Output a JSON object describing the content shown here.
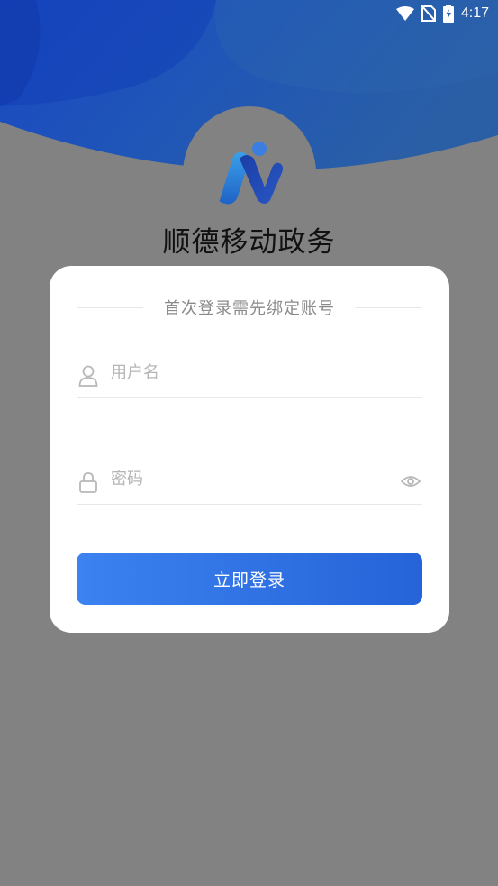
{
  "status_bar": {
    "time": "4:17",
    "icons": [
      "wifi-icon",
      "no-sim-icon",
      "battery-charging-icon"
    ]
  },
  "app": {
    "title": "顺德移动政务",
    "logo": "app-logo-icon"
  },
  "login_card": {
    "hint": "首次登录需先绑定账号",
    "username": {
      "placeholder": "用户名",
      "value": "",
      "icon": "user-icon"
    },
    "password": {
      "placeholder": "密码",
      "value": "",
      "icon": "lock-icon",
      "toggle_icon": "eye-icon"
    },
    "submit_label": "立即登录"
  },
  "colors": {
    "backdrop": "#828282",
    "header_blue": "#1f4fae",
    "button_start": "#3c82f0",
    "button_end": "#2563d8",
    "card": "#ffffff"
  }
}
